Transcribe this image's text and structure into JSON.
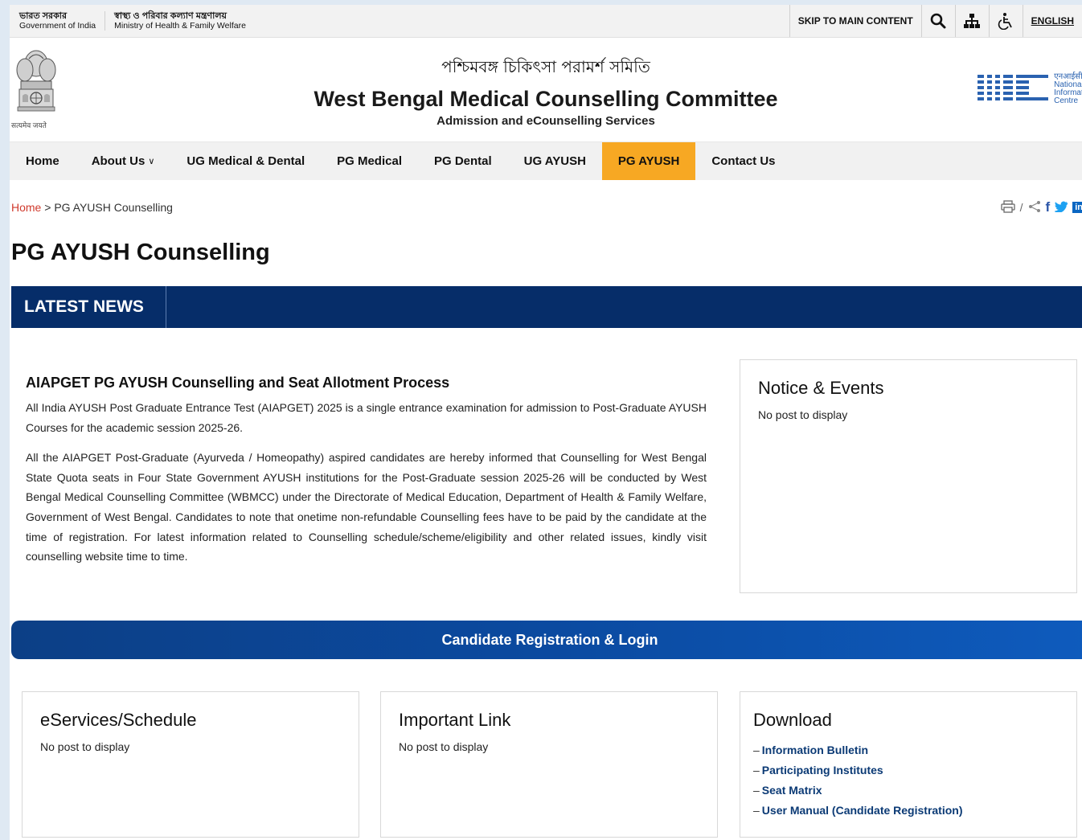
{
  "govbar": {
    "left1_l1": "ভারত সরকার",
    "left1_l2": "Government of India",
    "left2_l1": "স্বাস্থ্য ও পরিবার কল্যাণ মন্ত্রণালয়",
    "left2_l2": "Ministry of Health & Family Welfare",
    "skip": "SKIP TO MAIN CONTENT",
    "language": "ENGLISH"
  },
  "header": {
    "emblem_text": "सत्यमेव जयते",
    "title_bn": "পশ্চিমবঙ্গ চিকিৎসা পরামর্শ সমিতি",
    "title_en": "West Bengal Medical Counselling Committee",
    "subtitle": "Admission and eCounselling Services",
    "nic_line1": "एनआईसी",
    "nic_line2": "National",
    "nic_line3": "Informatics",
    "nic_line4": "Centre"
  },
  "nav": {
    "items": [
      {
        "label": "Home"
      },
      {
        "label": "About Us"
      },
      {
        "label": "UG Medical & Dental"
      },
      {
        "label": "PG Medical"
      },
      {
        "label": "PG Dental"
      },
      {
        "label": "UG AYUSH"
      },
      {
        "label": "PG AYUSH"
      },
      {
        "label": "Contact Us"
      }
    ]
  },
  "breadcrumb": {
    "home": "Home",
    "separator": ">",
    "current": "PG AYUSH Counselling"
  },
  "page": {
    "title": "PG AYUSH Counselling",
    "latest_news": "LATEST NEWS"
  },
  "article": {
    "heading": "AIAPGET PG AYUSH Counselling and Seat Allotment Process",
    "p1": "All India AYUSH Post Graduate Entrance Test (AIAPGET) 2025 is a single entrance examination for admission to Post-Graduate AYUSH Courses for the academic session 2025-26.",
    "p2": "All the AIAPGET Post-Graduate (Ayurveda / Homeopathy) aspired candidates are hereby informed that Counselling for West Bengal State Quota seats in Four State Government AYUSH institutions for the Post-Graduate session 2025-26 will be conducted by West Bengal Medical Counselling Committee (WBMCC) under the Directorate of Medical Education, Department of Health & Family Welfare, Government of West Bengal. Candidates to note that onetime non-refundable Counselling fees have to be paid by the candidate at the time of registration. For latest information related to Counselling schedule/scheme/eligibility and other related issues, kindly visit counselling website time to time."
  },
  "notice": {
    "title": "Notice & Events",
    "empty": "No post to display"
  },
  "registration": {
    "label": "Candidate Registration & Login"
  },
  "eservices": {
    "title": "eServices/Schedule",
    "empty": "No post to display"
  },
  "important": {
    "title": "Important Link",
    "empty": "No post to display"
  },
  "download": {
    "title": "Download",
    "items": [
      {
        "label": "Information Bulletin"
      },
      {
        "label": "Participating Institutes"
      },
      {
        "label": "Seat Matrix"
      },
      {
        "label": "User Manual (Candidate Registration)"
      }
    ]
  },
  "share": {
    "separator": "/"
  },
  "colors": {
    "nav_active": "#f7a823",
    "news_bar": "#062d69",
    "registration_bar": "#0b4aa0",
    "link": "#0b3a75",
    "breadcrumb_home": "#d03a2d"
  }
}
